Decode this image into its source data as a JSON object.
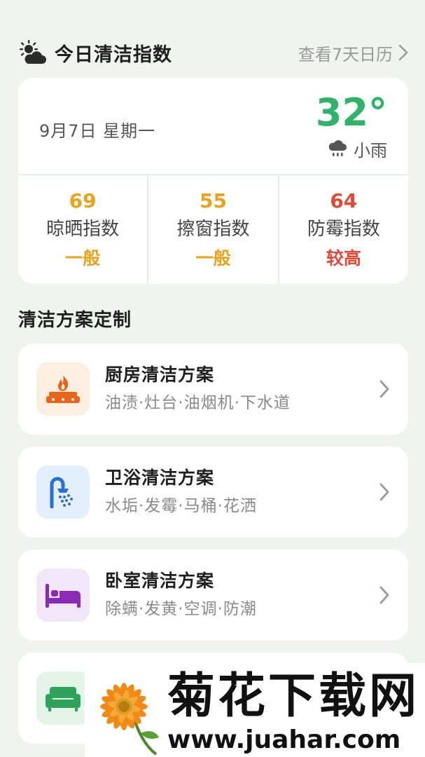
{
  "header": {
    "title": "今日清洁指数",
    "history_link": "查看7天日历"
  },
  "weather": {
    "date": "9月7日  星期一",
    "temperature": "32°",
    "condition": "小雨",
    "temp_color": "#2fb36a"
  },
  "indices": [
    {
      "value": "69",
      "label": "晾晒指数",
      "level": "一般",
      "color": "#e8a21c"
    },
    {
      "value": "55",
      "label": "擦窗指数",
      "level": "一般",
      "color": "#e8a21c"
    },
    {
      "value": "64",
      "label": "防霉指数",
      "level": "较高",
      "color": "#e04a3a"
    }
  ],
  "section": {
    "title": "清洁方案定制"
  },
  "plans": [
    {
      "title": "厨房清洁方案",
      "tags": "油渍·灶台·油烟机·下水道",
      "icon": "stove-fire-icon",
      "icon_bg": "#fdeee2",
      "icon_color": "#e8641c"
    },
    {
      "title": "卫浴清洁方案",
      "tags": "水垢·发霉·马桶·花洒",
      "icon": "shower-icon",
      "icon_bg": "#e4effd",
      "icon_color": "#2a6fd6"
    },
    {
      "title": "卧室清洁方案",
      "tags": "除螨·发黄·空调·防潮",
      "icon": "bed-icon",
      "icon_bg": "#f1e7f8",
      "icon_color": "#8a2bb8"
    },
    {
      "title": "",
      "tags": "",
      "icon": "sofa-icon",
      "icon_bg": "#e3f4e8",
      "icon_color": "#2fa35a"
    }
  ],
  "watermark": {
    "title": "菊花下载网",
    "url": "www.juahar.com"
  }
}
